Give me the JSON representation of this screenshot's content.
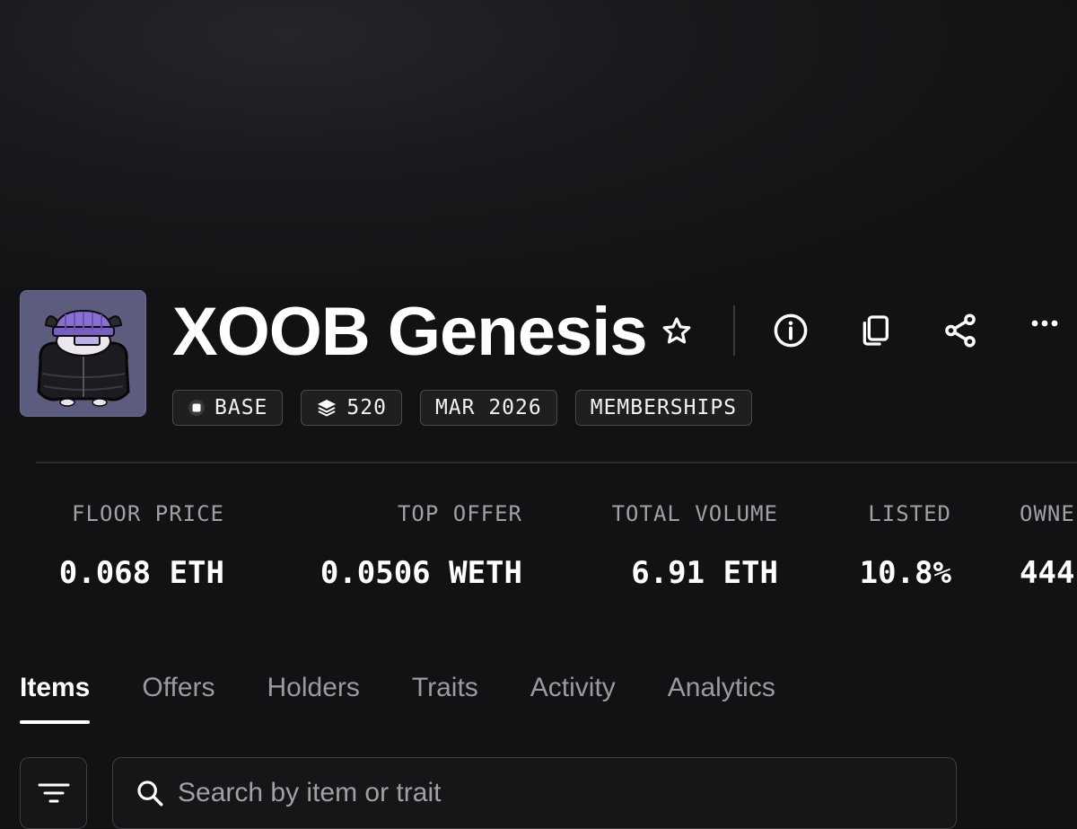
{
  "collection": {
    "name": "XOOB Genesis",
    "chips": [
      {
        "label": "BASE",
        "icon": "chain-icon"
      },
      {
        "label": "520",
        "icon": "layers-icon"
      },
      {
        "label": "MAR 2026",
        "icon": ""
      },
      {
        "label": "MEMBERSHIPS",
        "icon": ""
      }
    ]
  },
  "actions": {
    "favorite_icon": "star-icon",
    "info_icon": "info-icon",
    "copy_icon": "copy-icon",
    "share_icon": "share-icon",
    "more_icon": "more-icon"
  },
  "stats": [
    {
      "label": "FLOOR PRICE",
      "value": "0.068 ETH"
    },
    {
      "label": "TOP OFFER",
      "value": "0.0506 WETH"
    },
    {
      "label": "TOTAL VOLUME",
      "value": "6.91 ETH"
    },
    {
      "label": "LISTED",
      "value": "10.8%"
    },
    {
      "label": "OWNE",
      "value": "444"
    }
  ],
  "tabs": [
    {
      "label": "Items",
      "active": true
    },
    {
      "label": "Offers",
      "active": false
    },
    {
      "label": "Holders",
      "active": false
    },
    {
      "label": "Traits",
      "active": false
    },
    {
      "label": "Activity",
      "active": false
    },
    {
      "label": "Analytics",
      "active": false
    }
  ],
  "search": {
    "placeholder": "Search by item or trait",
    "value": ""
  },
  "colors": {
    "background": "#121214",
    "avatar_bg": "#5c5d7e",
    "beanie": "#8a6fd0",
    "muted_text": "#a0a0a6"
  }
}
